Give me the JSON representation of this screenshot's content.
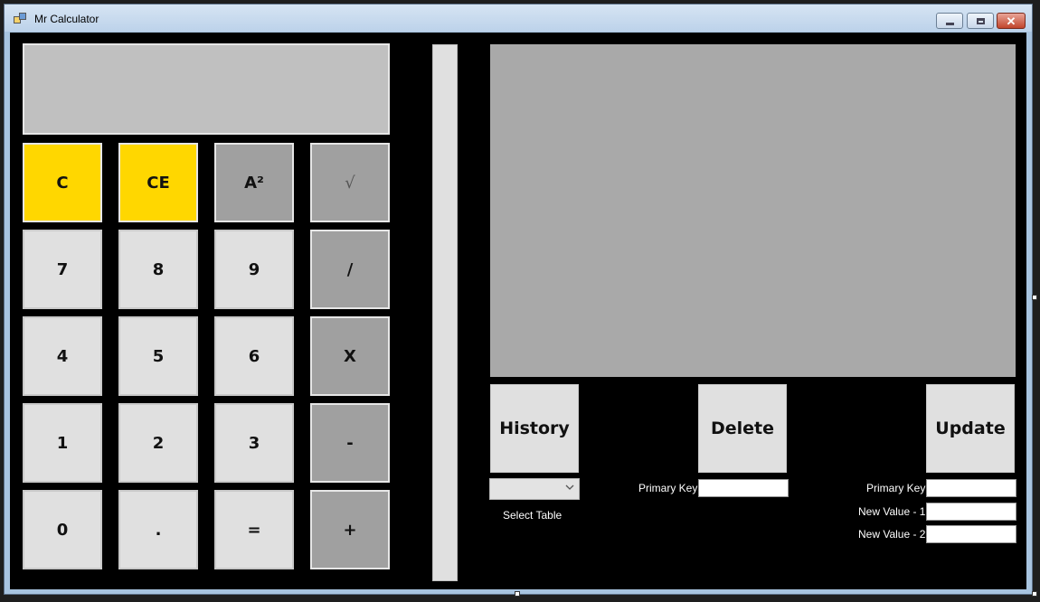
{
  "window": {
    "title": "Mr Calculator"
  },
  "calculator": {
    "display_value": "",
    "rows": [
      [
        {
          "label": "C",
          "style": "yellow",
          "name": "clear-button"
        },
        {
          "label": "CE",
          "style": "yellow",
          "name": "clear-entry-button"
        },
        {
          "label": "A²",
          "style": "op",
          "name": "square-button"
        },
        {
          "label": "√",
          "style": "op sqrt",
          "name": "sqrt-button"
        }
      ],
      [
        {
          "label": "7",
          "style": "",
          "name": "digit-7-button"
        },
        {
          "label": "8",
          "style": "",
          "name": "digit-8-button"
        },
        {
          "label": "9",
          "style": "",
          "name": "digit-9-button"
        },
        {
          "label": "/",
          "style": "op",
          "name": "divide-button"
        }
      ],
      [
        {
          "label": "4",
          "style": "",
          "name": "digit-4-button"
        },
        {
          "label": "5",
          "style": "",
          "name": "digit-5-button"
        },
        {
          "label": "6",
          "style": "",
          "name": "digit-6-button"
        },
        {
          "label": "X",
          "style": "op",
          "name": "multiply-button"
        }
      ],
      [
        {
          "label": "1",
          "style": "",
          "name": "digit-1-button"
        },
        {
          "label": "2",
          "style": "",
          "name": "digit-2-button"
        },
        {
          "label": "3",
          "style": "",
          "name": "digit-3-button"
        },
        {
          "label": "-",
          "style": "op",
          "name": "subtract-button"
        }
      ],
      [
        {
          "label": "0",
          "style": "",
          "name": "digit-0-button"
        },
        {
          "label": ".",
          "style": "",
          "name": "decimal-button"
        },
        {
          "label": "=",
          "style": "",
          "name": "equals-button"
        },
        {
          "label": "+",
          "style": "op",
          "name": "add-button"
        }
      ]
    ]
  },
  "database": {
    "history_label": "History",
    "delete_label": "Delete",
    "update_label": "Update",
    "select_table_label": "Select Table",
    "select_table_value": "",
    "delete_primary_key_label": "Primary Key",
    "delete_primary_key_value": "",
    "update_primary_key_label": "Primary Key",
    "update_primary_key_value": "",
    "new_value_1_label": "New Value - 1",
    "new_value_1_value": "",
    "new_value_2_label": "New Value - 2",
    "new_value_2_value": ""
  },
  "colors": {
    "background": "#000000",
    "yellow_key": "#ffd700",
    "operator_key": "#a0a0a0",
    "digit_key": "#e0e0e0",
    "display": "#c0c0c0",
    "grid": "#a9a9a9"
  }
}
